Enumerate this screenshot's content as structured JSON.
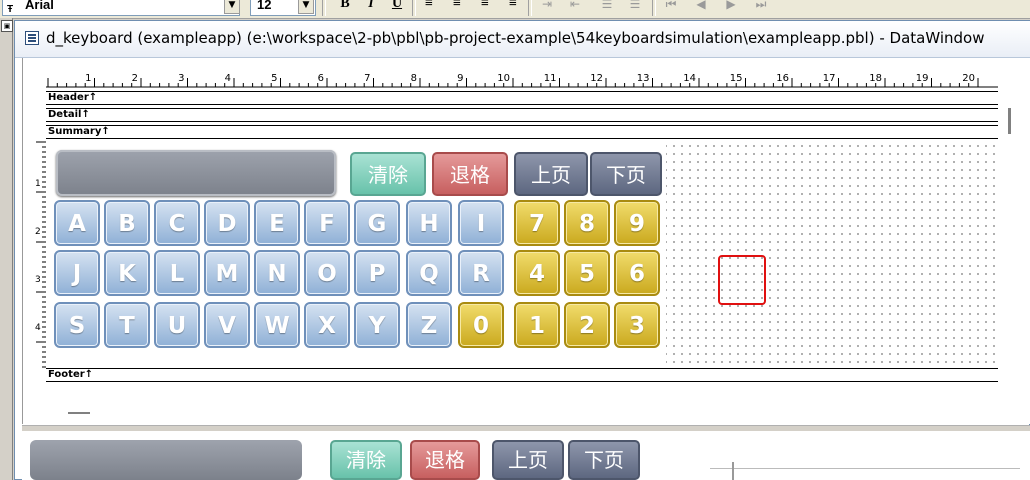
{
  "toolbar": {
    "font_name": "Arial",
    "font_size": "12",
    "bold": "B",
    "italic": "I",
    "underline": "U"
  },
  "window": {
    "title": "d_keyboard  (exampleapp) (e:\\workspace\\2-pb\\pbl\\pb-project-example\\54keyboardsimulation\\exampleapp.pbl) - DataWindow"
  },
  "ruler": {
    "numbers": [
      "1",
      "2",
      "3",
      "4",
      "5",
      "6",
      "7",
      "8",
      "9",
      "10",
      "11",
      "12",
      "13",
      "14",
      "15",
      "16",
      "17",
      "18",
      "19",
      "20"
    ],
    "vnumbers": [
      "1",
      "2",
      "3",
      "4"
    ]
  },
  "bands": {
    "header": "Header↑",
    "detail": "Detail↑",
    "summary": "Summary↑",
    "footer": "Footer↑"
  },
  "keyboard": {
    "row1": [
      "A",
      "B",
      "C",
      "D",
      "E",
      "F",
      "G",
      "H",
      "I"
    ],
    "row2": [
      "J",
      "K",
      "L",
      "M",
      "N",
      "O",
      "P",
      "Q",
      "R"
    ],
    "row3": [
      "S",
      "T",
      "U",
      "V",
      "W",
      "X",
      "Y",
      "Z"
    ],
    "zero": "0",
    "digits": [
      [
        "7",
        "8",
        "9"
      ],
      [
        "4",
        "5",
        "6"
      ],
      [
        "1",
        "2",
        "3"
      ]
    ],
    "clear": "清除",
    "backspace": "退格",
    "page_up": "上页",
    "page_down": "下页"
  },
  "colors": {
    "blue_key": "#8fb0d6",
    "yellow_key": "#caa91e",
    "clear": "#68c2aa",
    "backspace": "#c75f5f",
    "page": "#5d6780",
    "highlight": "#e01010"
  }
}
